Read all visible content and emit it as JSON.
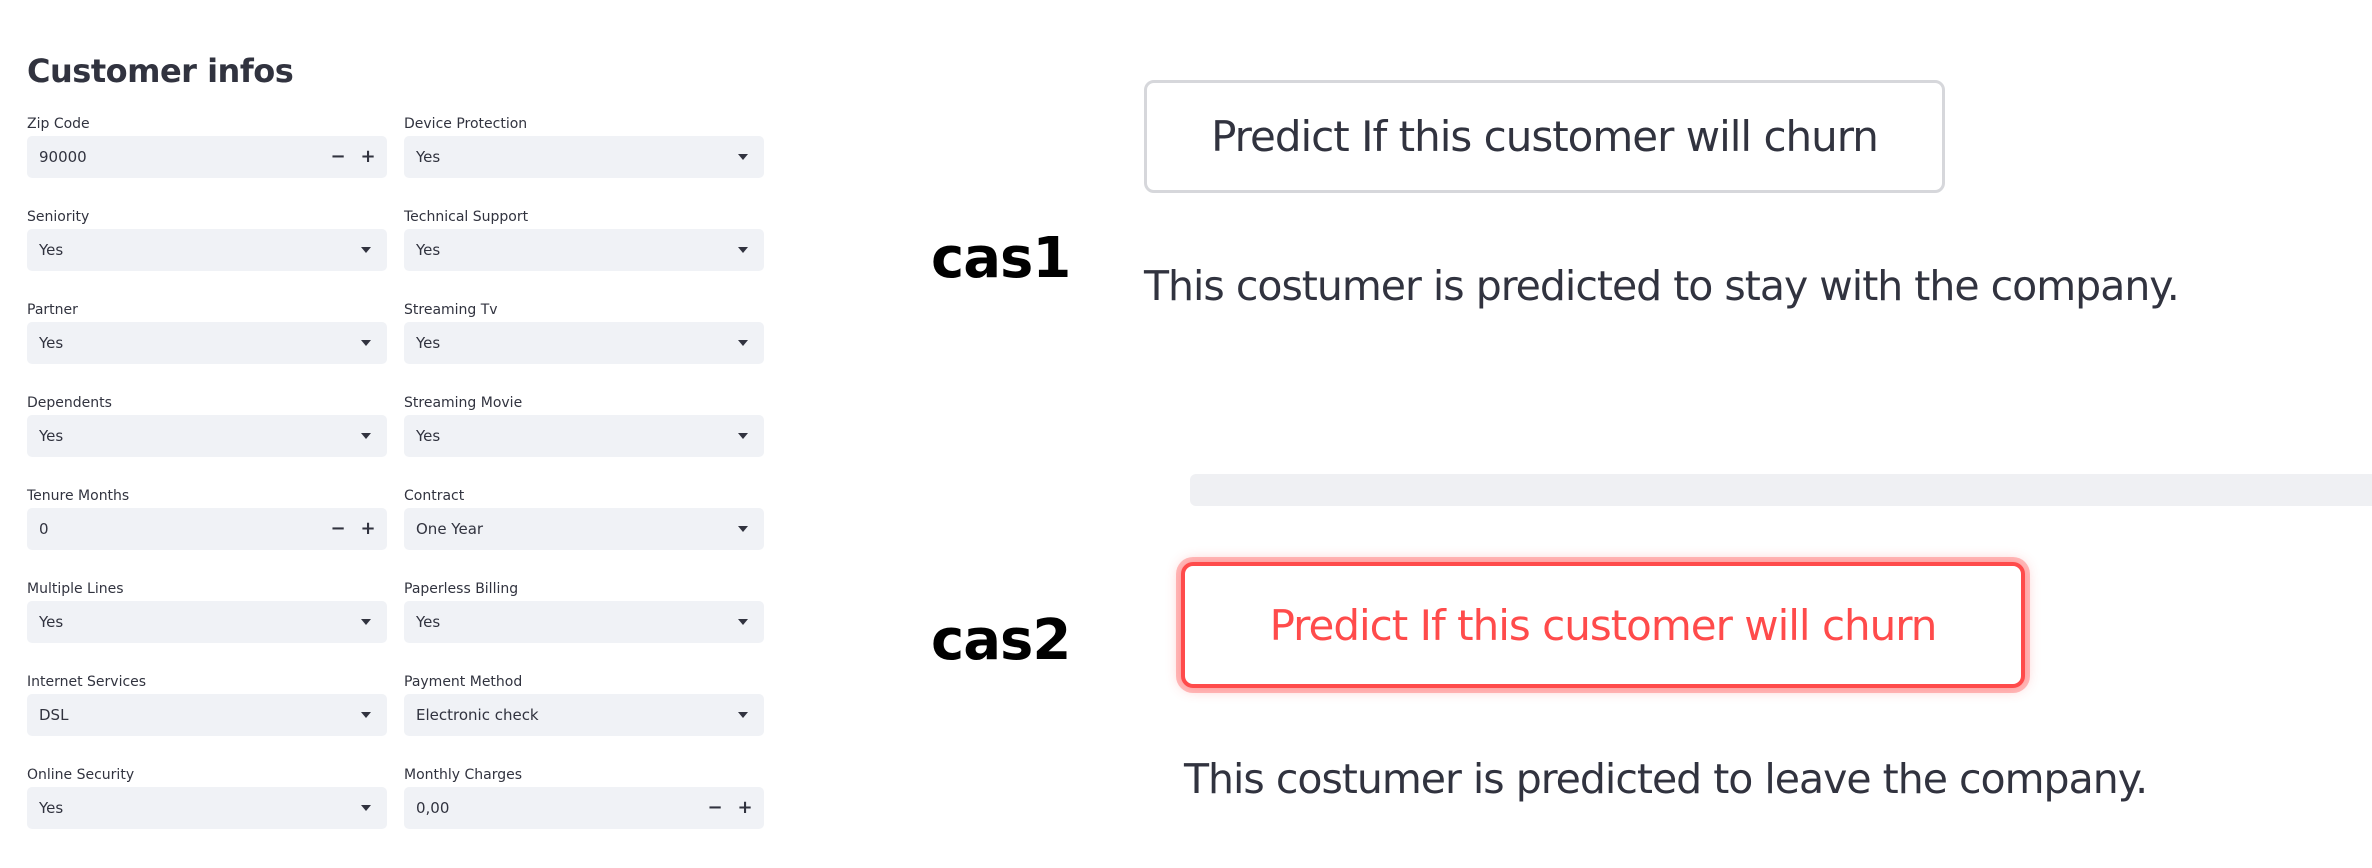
{
  "form": {
    "title": "Customer infos",
    "left_fields": [
      {
        "label": "Zip Code",
        "value": "90000",
        "kind": "number",
        "minus": "−",
        "plus": "+"
      },
      {
        "label": "Seniority",
        "value": "Yes",
        "kind": "select"
      },
      {
        "label": "Partner",
        "value": "Yes",
        "kind": "select"
      },
      {
        "label": "Dependents",
        "value": "Yes",
        "kind": "select"
      },
      {
        "label": "Tenure Months",
        "value": "0",
        "kind": "number",
        "minus": "−",
        "plus": "+"
      },
      {
        "label": "Multiple Lines",
        "value": "Yes",
        "kind": "select"
      },
      {
        "label": "Internet Services",
        "value": "DSL",
        "kind": "select"
      },
      {
        "label": "Online Security",
        "value": "Yes",
        "kind": "select"
      }
    ],
    "right_fields": [
      {
        "label": "Device Protection",
        "value": "Yes",
        "kind": "select"
      },
      {
        "label": "Technical Support",
        "value": "Yes",
        "kind": "select"
      },
      {
        "label": "Streaming Tv",
        "value": "Yes",
        "kind": "select"
      },
      {
        "label": "Streaming Movie",
        "value": "Yes",
        "kind": "select"
      },
      {
        "label": "Contract",
        "value": "One Year",
        "kind": "select"
      },
      {
        "label": "Paperless Billing",
        "value": "Yes",
        "kind": "select"
      },
      {
        "label": "Payment Method",
        "value": "Electronic check",
        "kind": "select"
      },
      {
        "label": "Monthly Charges",
        "value": "0,00",
        "kind": "number",
        "minus": "−",
        "plus": "+"
      }
    ]
  },
  "cases": {
    "case1": {
      "label": "cas1",
      "button_label": "Predict If this customer will churn",
      "result": "This costumer is predicted to stay with the company."
    },
    "case2": {
      "label": "cas2",
      "button_label": "Predict If this customer will churn",
      "result": "This costumer is predicted to leave the company."
    }
  },
  "colors": {
    "accent": "#ff4b4b",
    "input_bg": "#f0f2f6",
    "text": "#31333f",
    "button_border": "#d6d7db"
  },
  "icons": {
    "select": "chevron-down-icon",
    "stepper_minus": "minus-icon",
    "stepper_plus": "plus-icon"
  }
}
